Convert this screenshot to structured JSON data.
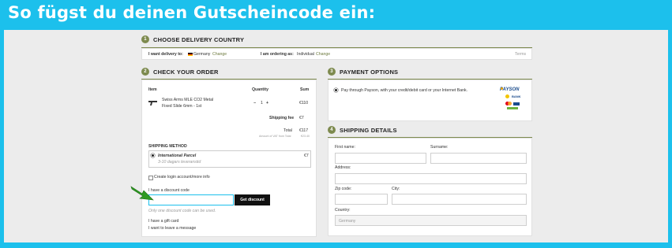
{
  "banner": {
    "title": "So fügst du deinen Gutscheincode ein:"
  },
  "colors": {
    "frame": "#1cc0ec",
    "accent": "#7d8a4e",
    "arrow": "#2e9b22",
    "highlight": "#1cc0ec"
  },
  "delivery": {
    "number": "1",
    "heading": "CHOOSE DELIVERY COUNTRY",
    "deliver_label": "I want delivery to:",
    "country": "Germany",
    "change1": "Change",
    "ordering_label": "I am ordering as:",
    "ordering_value": "Individual",
    "change2": "Change",
    "terms": "Terms"
  },
  "order": {
    "number": "2",
    "heading": "CHECK YOUR ORDER",
    "col_item": "Item",
    "col_qty": "Quantity",
    "col_sum": "Sum",
    "product_name_line1": "Swiss Arms MLE CO2 Metal",
    "product_name_line2": "Fixed Slide 6mm - 1st",
    "qty_minus": "−",
    "qty_value": "1",
    "qty_plus": "+",
    "product_sum": "€110",
    "shipping_fee_label": "Shipping fee",
    "shipping_fee_value": "€7",
    "total_label": "Total",
    "total_value": "€117",
    "vat_label": "Amount of VAT from Total",
    "vat_value": "€23.40",
    "shipping_method_label": "SHIPPING METHOD",
    "method_name": "International Parcel",
    "method_days": "3-10 dagars leveranstid",
    "method_price": "€7",
    "create_login": "Create login account/more info",
    "discount_label": "I have a discount code",
    "discount_button": "Get discount",
    "discount_note": "Only one discount code can be used.",
    "gift_card": "I have a gift card",
    "leave_message": "I want to leave a message"
  },
  "payment": {
    "number": "3",
    "heading": "PAYMENT OPTIONS",
    "option_text": "Pay through Payson, with your credit/debit card or your Internet Bank.",
    "logo_word": "PAYSON",
    "logo_sub": "BANK"
  },
  "shipping_details": {
    "number": "4",
    "heading": "SHIPPING DETAILS",
    "first_name": "First name:",
    "surname": "Surname:",
    "address": "Address:",
    "zip": "Zip code:",
    "city": "City:",
    "country_label": "Country:",
    "country_value": "Germany"
  },
  "icons": [
    "arrow-pointer-icon",
    "gun-thumbnail-icon",
    "payson-logo-icon",
    "flag-germany-icon",
    "radio-selected-icon",
    "checkbox-icon"
  ]
}
